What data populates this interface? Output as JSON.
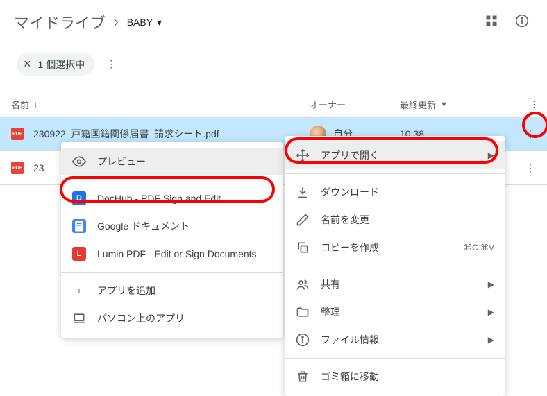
{
  "breadcrumb": {
    "root": "マイドライブ",
    "current": "BABY"
  },
  "selection": {
    "close": "×",
    "text": "1 個選択中"
  },
  "headers": {
    "name": "名前",
    "owner": "オーナー",
    "modified": "最終更新"
  },
  "rows": [
    {
      "name": "230922_戸籍国籍関係届書_請求シート.pdf",
      "owner": "自分",
      "modified": "10:38"
    },
    {
      "name": "23"
    }
  ],
  "leftMenu": {
    "preview": "プレビュー",
    "apps": [
      {
        "name": "DocHub - PDF Sign and Edit",
        "cls": "dochub",
        "letter": "D"
      },
      {
        "name": "Google ドキュメント",
        "cls": "gdoc",
        "letter": ""
      },
      {
        "name": "Lumin PDF - Edit or Sign Documents",
        "cls": "lumin",
        "letter": "L"
      }
    ],
    "addApp": "アプリを追加",
    "desktopApp": "パソコン上のアプリ"
  },
  "rightMenu": {
    "openWith": "アプリで開く",
    "download": "ダウンロード",
    "rename": "名前を変更",
    "copy": "コピーを作成",
    "copyShortcut": "⌘C ⌘V",
    "share": "共有",
    "organize": "整理",
    "info": "ファイル情報",
    "trash": "ゴミ箱に移動"
  }
}
